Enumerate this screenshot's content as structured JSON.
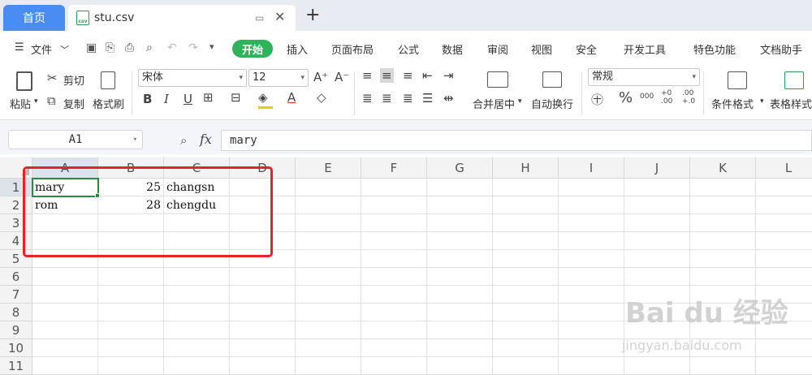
{
  "tabs": {
    "home": "首页",
    "file": "stu.csv",
    "file_icon": "csv",
    "add": "+",
    "close": "✕"
  },
  "menu": {
    "file": "文件",
    "items": [
      "开始",
      "插入",
      "页面布局",
      "公式",
      "数据",
      "审阅",
      "视图",
      "安全",
      "开发工具",
      "特色功能",
      "文档助手"
    ]
  },
  "ribbon": {
    "paste": "粘贴",
    "cut": "剪切",
    "copy": "复制",
    "format_painter": "格式刷",
    "font_name": "宋体",
    "font_size": "12",
    "merge": "合并居中",
    "wrap": "自动换行",
    "number_format": "常规",
    "percent": "%",
    "thousands": "000",
    "inc_decimal": "+0\n.00",
    "dec_decimal": ".00\n+.0",
    "cond_format": "条件格式",
    "table_style": "表格样式"
  },
  "formula_bar": {
    "cell_ref": "A1",
    "fx": "fx",
    "value": "mary"
  },
  "grid": {
    "columns": [
      "A",
      "B",
      "C",
      "D",
      "E",
      "F",
      "G",
      "H",
      "I",
      "J",
      "K",
      "L"
    ],
    "rows": [
      "1",
      "2",
      "3",
      "4",
      "5",
      "6",
      "7",
      "8",
      "9",
      "10",
      "11"
    ],
    "data": [
      [
        "mary",
        "25",
        "changsn"
      ],
      [
        "rom",
        "28",
        "chengdu"
      ]
    ]
  },
  "watermark": {
    "brand": "Bai du 经验",
    "url": "jingyan.baidu.com"
  },
  "colors": {
    "accent": "#4a8df2",
    "start_button": "#2fb35a",
    "selection": "#2a8a42",
    "highlight_box": "#e8202a"
  }
}
